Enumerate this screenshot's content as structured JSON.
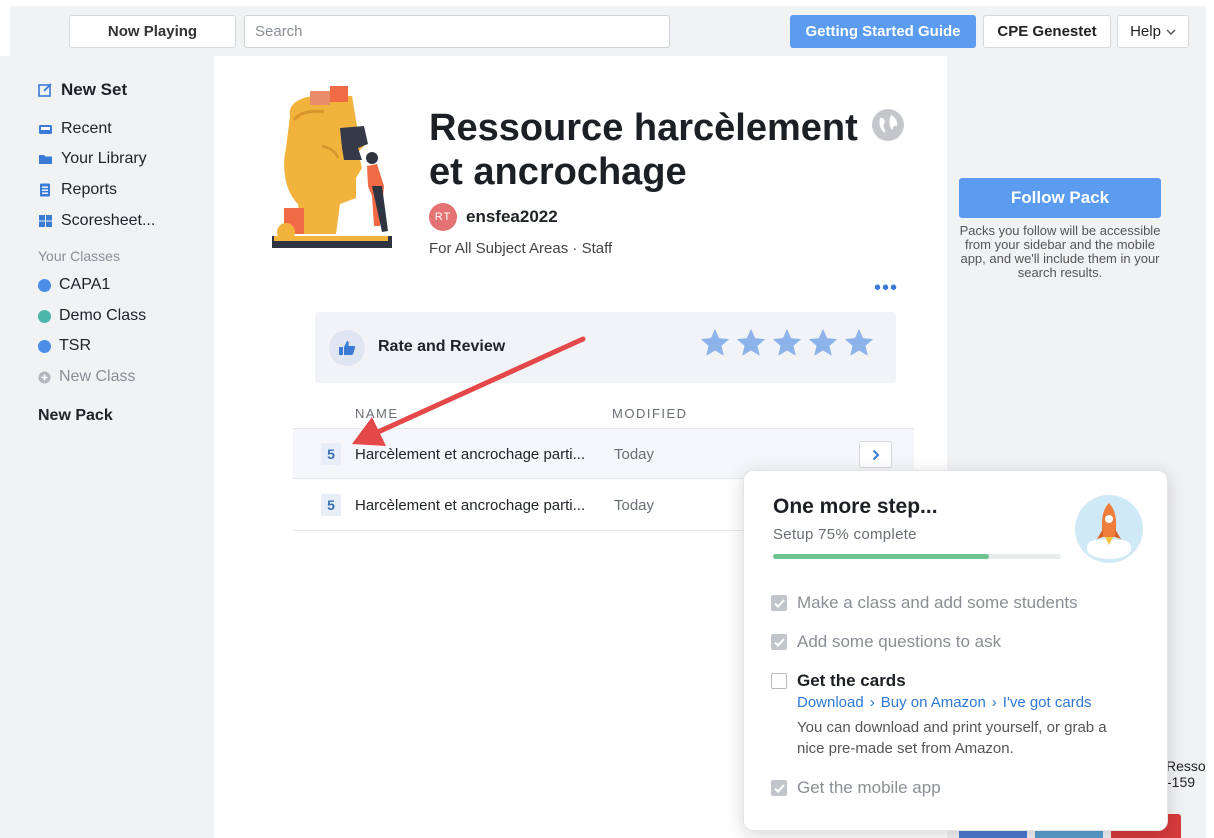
{
  "topbar": {
    "now_playing": "Now Playing",
    "search_placeholder": "Search",
    "getting_started": "Getting Started Guide",
    "account": "CPE Genestet",
    "help": "Help"
  },
  "sidebar": {
    "new_set": "New Set",
    "recent": "Recent",
    "library": "Your Library",
    "reports": "Reports",
    "scoresheet": "Scoresheet...",
    "classes_heading": "Your Classes",
    "classes": [
      {
        "label": "CAPA1",
        "color": "#4a8fe7"
      },
      {
        "label": "Demo Class",
        "color": "#4db6ac"
      },
      {
        "label": "TSR",
        "color": "#4a8fe7"
      }
    ],
    "new_class": "New Class",
    "new_pack": "New Pack"
  },
  "pack": {
    "title": "Ressource harcèlement et ancrochage",
    "author_initials": "RT",
    "author": "ensfea2022",
    "subjects": "For All Subject Areas · Staff",
    "rate_label": "Rate and Review",
    "star_color": "#8db4ea",
    "columns": {
      "name": "NAME",
      "modified": "MODIFIED"
    },
    "rows": [
      {
        "count": "5",
        "name": "Harcèlement et ancrochage parti...",
        "modified": "Today"
      },
      {
        "count": "5",
        "name": "Harcèlement et ancrochage parti...",
        "modified": "Today"
      }
    ]
  },
  "right": {
    "follow": "Follow Pack",
    "follow_desc": "Packs you follow will be accessible from your sidebar and the mobile app, and we'll include them in your search results.",
    "peek_line1": "Resso",
    "peek_line2": "-159"
  },
  "setup": {
    "title": "One more step...",
    "subtitle": "Setup 75% complete",
    "progress": 0.75,
    "steps": {
      "class": "Make a class and add some students",
      "questions": "Add some questions to ask",
      "cards": "Get the cards",
      "mobile": "Get the mobile app"
    },
    "links": {
      "download": "Download",
      "amazon": "Buy on Amazon",
      "got": "I've got cards"
    },
    "cards_desc": "You can download and print yourself, or grab a nice pre-made set from Amazon."
  },
  "colors": {
    "accent": "#5b9cf0",
    "progress": "#6ec48f",
    "arrow": "#e54848"
  }
}
